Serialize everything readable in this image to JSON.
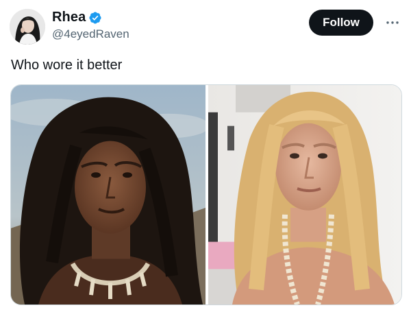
{
  "author": {
    "display_name": "Rhea",
    "handle": "@4eyedRaven",
    "verified": true,
    "avatar_icon": "profile-photo"
  },
  "actions": {
    "follow_label": "Follow",
    "more_icon": "more-horizontal-icon"
  },
  "tweet": {
    "text": "Who wore it better"
  },
  "media": {
    "photos": [
      {
        "description_icon": "photo-dark-long-hair-man"
      },
      {
        "description_icon": "photo-blonde-long-hair-man"
      }
    ]
  },
  "colors": {
    "text_primary": "#0f1419",
    "text_secondary": "#536471",
    "verified_blue": "#1d9bf0",
    "follow_bg": "#0f1419",
    "border": "#cfd9de"
  }
}
